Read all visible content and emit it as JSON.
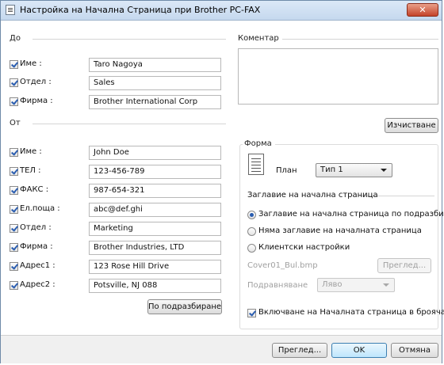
{
  "window": {
    "title": "Настройка на Начална Страница при Brother PC-FAX",
    "close_label": "✕"
  },
  "to_group": {
    "title": "До",
    "fields": [
      {
        "label": "Име :",
        "value": "Taro Nagoya",
        "checked": true
      },
      {
        "label": "Отдел :",
        "value": "Sales",
        "checked": true
      },
      {
        "label": "Фирма :",
        "value": "Brother International Corp",
        "checked": true
      }
    ]
  },
  "from_group": {
    "title": "От",
    "fields": [
      {
        "label": "Име :",
        "value": "John Doe",
        "checked": true
      },
      {
        "label": "ТЕЛ :",
        "value": "123-456-789",
        "checked": true
      },
      {
        "label": "ФАКС :",
        "value": "987-654-321",
        "checked": true
      },
      {
        "label": "Ел.поща :",
        "value": "abc@def.ghi",
        "checked": true
      },
      {
        "label": "Отдел :",
        "value": "Marketing",
        "checked": true
      },
      {
        "label": "Фирма :",
        "value": "Brother Industries, LTD",
        "checked": true
      },
      {
        "label": "Адрес1 :",
        "value": "123 Rose Hill Drive",
        "checked": true
      },
      {
        "label": "Адрес2 :",
        "value": "Potsville, NJ 088",
        "checked": true
      }
    ],
    "default_button": "По подразбиране"
  },
  "comment": {
    "title": "Коментар",
    "value": "",
    "clear_button": "Изчистване"
  },
  "form": {
    "title": "Форма",
    "plan_label": "План",
    "plan_value": "Тип 1",
    "cover_heading": "Заглавие на начална страница",
    "options": [
      {
        "label": "Заглавие на начална страница по подразбиране",
        "selected": true
      },
      {
        "label": "Няма заглавие на началната страница",
        "selected": false
      },
      {
        "label": "Клиентски настройки",
        "selected": false
      }
    ],
    "file_name": "Cover01_Bul.bmp",
    "browse_button": "Преглед...",
    "align_label": "Подравняване",
    "align_value": "Ляво",
    "include_label": "Включване на Началната страница в брояча",
    "include_checked": true
  },
  "footer": {
    "preview": "Преглед...",
    "ok": "OK",
    "cancel": "Отмяна"
  }
}
